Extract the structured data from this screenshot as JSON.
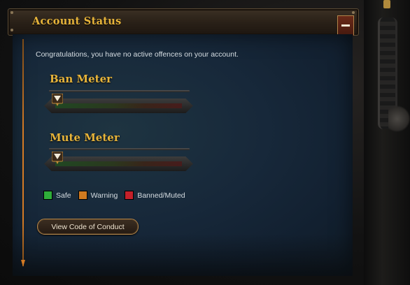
{
  "header": {
    "title": "Account Status",
    "collapse_icon": "minus-icon"
  },
  "message": "Congratulations, you have no active offences on your account.",
  "meters": [
    {
      "title": "Ban Meter",
      "level": 0
    },
    {
      "title": "Mute Meter",
      "level": 0
    }
  ],
  "legend": [
    {
      "label": "Safe",
      "color": "#2fae3a"
    },
    {
      "label": "Warning",
      "color": "#d07a20"
    },
    {
      "label": "Banned/Muted",
      "color": "#c4202a"
    }
  ],
  "button": {
    "label": "View Code of Conduct"
  },
  "colors": {
    "accent_gold": "#e7b43a",
    "accent_orange": "#d47a24",
    "panel_blue": "#17283a"
  }
}
